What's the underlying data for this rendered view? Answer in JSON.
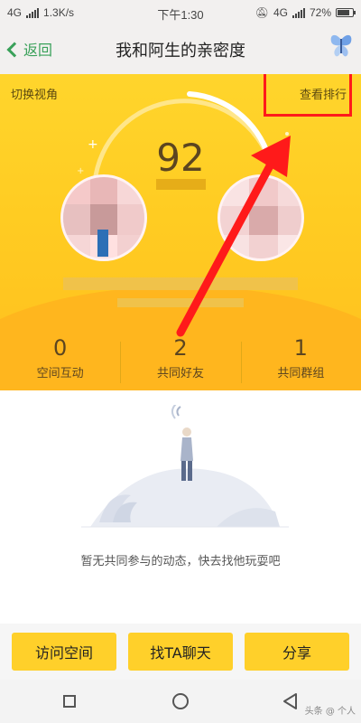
{
  "status_bar": {
    "network_left": "4G",
    "speed": "1.3K/s",
    "time": "下午1:30",
    "network_right": "4G",
    "battery": "72%"
  },
  "nav": {
    "back_label": "返回",
    "title": "我和阿生的亲密度"
  },
  "hero": {
    "switch_view": "切换视角",
    "view_ranking": "查看排行",
    "score": "92"
  },
  "stats": [
    {
      "value": "0",
      "label": "空间互动"
    },
    {
      "value": "2",
      "label": "共同好友"
    },
    {
      "value": "1",
      "label": "共同群组"
    }
  ],
  "empty_state": {
    "message": "暂无共同参与的动态，快去找他玩耍吧"
  },
  "actions": {
    "visit_space": "访问空间",
    "chat": "找TA聊天",
    "share": "分享"
  },
  "watermark": "头条 @ 个人"
}
